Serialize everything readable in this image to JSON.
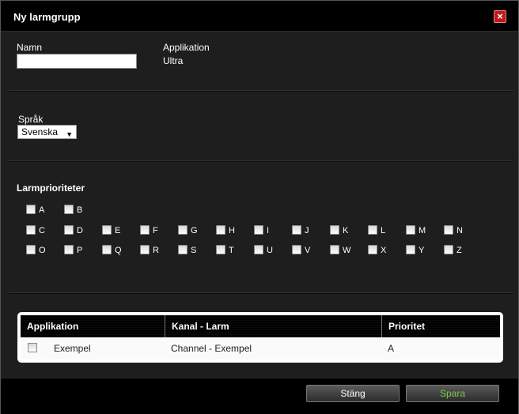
{
  "dialog": {
    "title": "Ny larmgrupp",
    "close_glyph": "×"
  },
  "form": {
    "name_label": "Namn",
    "name_value": "",
    "application_label": "Applikation",
    "application_value": "Ultra",
    "language_label": "Språk",
    "language_selected": "Svenska"
  },
  "priorities": {
    "title": "Larmprioriteter",
    "items": [
      "A",
      "B",
      "C",
      "D",
      "E",
      "F",
      "G",
      "H",
      "I",
      "J",
      "K",
      "L",
      "M",
      "N",
      "O",
      "P",
      "Q",
      "R",
      "S",
      "T",
      "U",
      "V",
      "W",
      "X",
      "Y",
      "Z"
    ]
  },
  "table": {
    "columns": [
      "Applikation",
      "Kanal - Larm",
      "Prioritet"
    ],
    "rows": [
      {
        "checked": false,
        "application": "Exempel",
        "channel": "Channel - Exempel",
        "priority": "A"
      }
    ]
  },
  "footer": {
    "close_label": "Stäng",
    "save_label": "Spara"
  },
  "colors": {
    "title_bar": "#000000",
    "body": "#1e1e1e",
    "close_button": "#c0181a",
    "save_text": "#7ac943"
  },
  "icons": {
    "close": "close-icon",
    "dropdown": "chevron-down-icon"
  }
}
